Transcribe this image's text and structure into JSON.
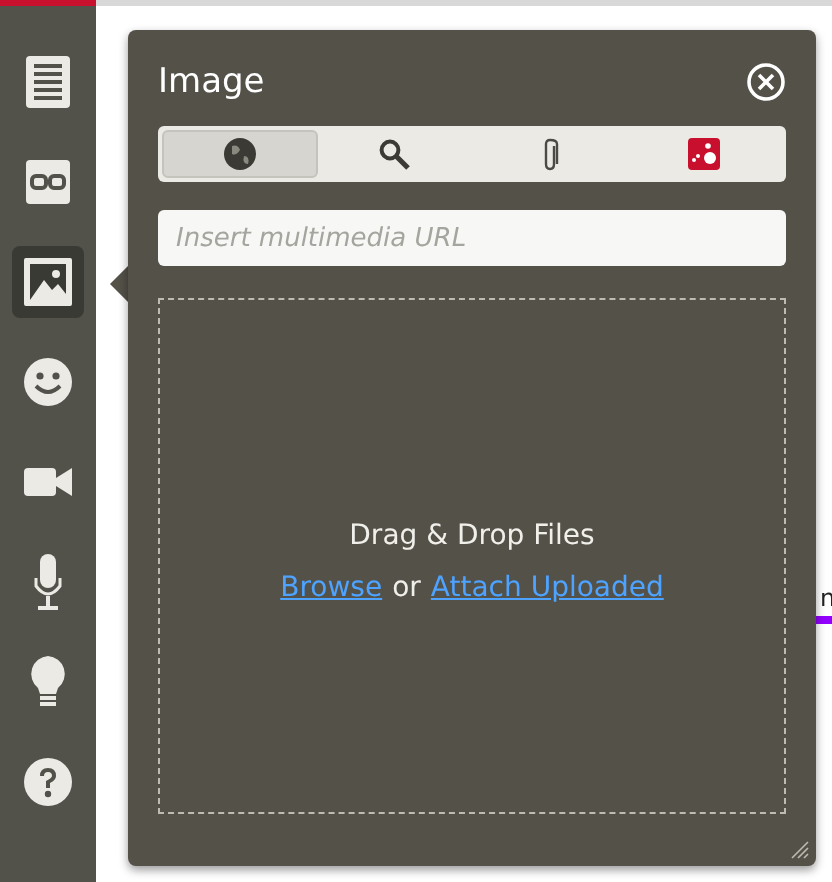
{
  "sidebar": {
    "items": [
      {
        "kind": "document",
        "selected": false
      },
      {
        "kind": "link",
        "selected": false
      },
      {
        "kind": "image",
        "selected": true
      },
      {
        "kind": "emoji",
        "selected": false
      },
      {
        "kind": "video",
        "selected": false
      },
      {
        "kind": "audio",
        "selected": false
      },
      {
        "kind": "idea",
        "selected": false
      },
      {
        "kind": "help",
        "selected": false
      }
    ]
  },
  "panel": {
    "title": "Image",
    "tabs": [
      {
        "kind": "web",
        "selected": true
      },
      {
        "kind": "search",
        "selected": false
      },
      {
        "kind": "attach",
        "selected": false
      },
      {
        "kind": "app",
        "selected": false
      }
    ],
    "url_field": {
      "placeholder": "Insert multimedia URL"
    },
    "drop_zone": {
      "text": "Drag & Drop Files",
      "browse_link": "Browse",
      "separator": "or",
      "attach_link": "Attach Uploaded"
    }
  },
  "background_text": "n"
}
